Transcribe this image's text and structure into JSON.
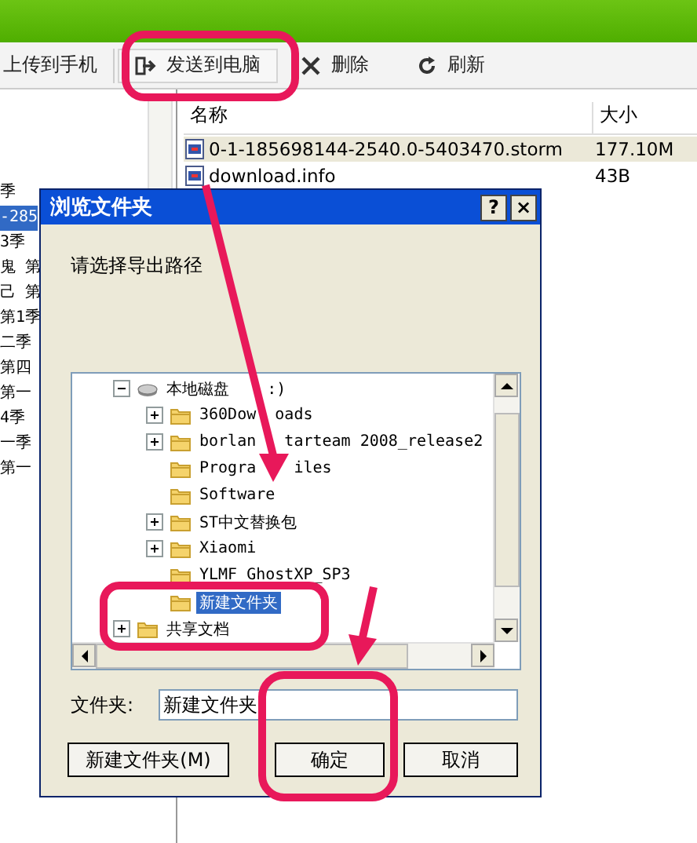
{
  "toolbar": {
    "items": [
      {
        "kind": "plain",
        "label": "上传到手机"
      },
      {
        "kind": "send",
        "label": "发送到电脑"
      },
      {
        "kind": "delete",
        "label": "删除"
      },
      {
        "kind": "refresh",
        "label": "刷新"
      }
    ]
  },
  "left_pane": {
    "items": [
      {
        "label": "季",
        "selected": false
      },
      {
        "label": "-285",
        "selected": true
      },
      {
        "label": "3季",
        "selected": false
      },
      {
        "label": "鬼 第",
        "selected": false
      },
      {
        "label": "己 第",
        "selected": false
      },
      {
        "label": "第1季",
        "selected": false
      },
      {
        "label": "二季",
        "selected": false
      },
      {
        "label": "第四",
        "selected": false
      },
      {
        "label": "第一",
        "selected": false
      },
      {
        "label": "4季",
        "selected": false
      },
      {
        "label": "一季",
        "selected": false
      },
      {
        "label": "第一",
        "selected": false
      }
    ]
  },
  "file_list": {
    "columns": [
      "名称",
      "大小"
    ],
    "rows": [
      {
        "name": "0-1-185698144-2540.0-5403470.storm",
        "size": "177.10M",
        "selected": true
      },
      {
        "name": "download.info",
        "size": "43B",
        "selected": false
      }
    ]
  },
  "dialog": {
    "title": "浏览文件夹",
    "title_buttons": [
      "?",
      "×"
    ],
    "prompt": "请选择导出路径",
    "tree": [
      {
        "label": "本地磁盘    :)",
        "kind": "drive",
        "expanded": true,
        "selected": false,
        "children": [
          {
            "label": "360Dow  oads",
            "kind": "folder",
            "expanded": false,
            "selected": false
          },
          {
            "label": "borlan   tarteam 2008_release2",
            "kind": "folder",
            "expanded": false,
            "selected": false
          },
          {
            "label": "Progra    iles",
            "kind": "folder",
            "selected": false
          },
          {
            "label": "Software",
            "kind": "folder",
            "selected": false
          },
          {
            "label": "ST中文替换包",
            "kind": "folder",
            "expanded": false,
            "selected": false
          },
          {
            "label": "Xiaomi",
            "kind": "folder",
            "expanded": false,
            "selected": false
          },
          {
            "label": "YLMF_GhostXP_SP3",
            "kind": "folder",
            "selected": false
          },
          {
            "label": "新建文件夹",
            "kind": "folder",
            "selected": true
          }
        ]
      },
      {
        "label": "共享文档",
        "kind": "folder",
        "expanded": false,
        "selected": false
      }
    ],
    "folder_label": "文件夹:",
    "folder_value": "新建文件夹",
    "buttons": [
      "新建文件夹(M)",
      "确定",
      "取消"
    ]
  }
}
